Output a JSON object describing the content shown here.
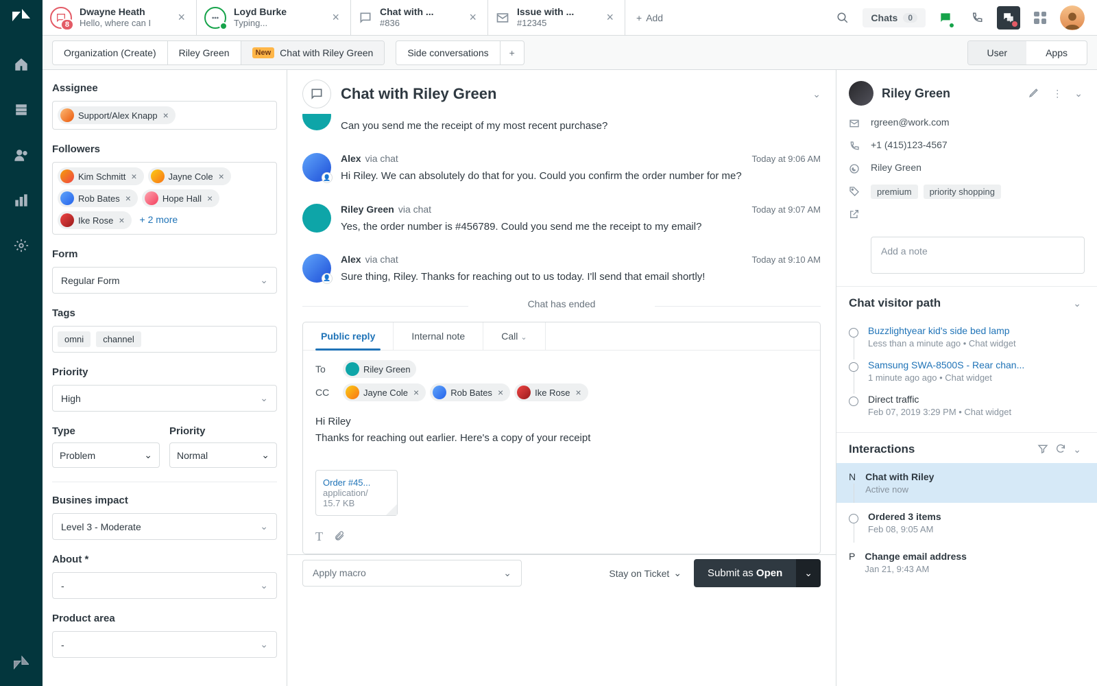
{
  "topbar": {
    "tabs": [
      {
        "title": "Dwayne Heath",
        "subtitle": "Hello, where can I",
        "badge": "8"
      },
      {
        "title": "Loyd Burke",
        "subtitle": "Typing..."
      },
      {
        "title": "Chat with ...",
        "subtitle": "#836"
      },
      {
        "title": "Issue with ...",
        "subtitle": "#12345"
      }
    ],
    "add_label": "Add",
    "chats_label": "Chats",
    "chats_count": "0"
  },
  "subbar": {
    "tab1": "Organization (Create)",
    "tab2": "Riley Green",
    "tab3_badge": "New",
    "tab3": "Chat with Riley Green",
    "side_conversations": "Side conversations",
    "user": "User",
    "apps": "Apps"
  },
  "sidebar": {
    "assignee_label": "Assignee",
    "assignee_value": "Support/Alex Knapp",
    "followers_label": "Followers",
    "followers": [
      "Kim Schmitt",
      "Jayne Cole",
      "Rob Bates",
      "Hope Hall",
      "Ike Rose"
    ],
    "followers_more": "+ 2 more",
    "form_label": "Form",
    "form_value": "Regular Form",
    "tags_label": "Tags",
    "tags": [
      "omni",
      "channel"
    ],
    "priority_label": "Priority",
    "priority_value": "High",
    "type_label": "Type",
    "type_value": "Problem",
    "priority2_label": "Priority",
    "priority2_value": "Normal",
    "business_label": "Busines impact",
    "business_value": "Level 3 - Moderate",
    "about_label": "About *",
    "about_value": "-",
    "product_label": "Product area",
    "product_value": "-"
  },
  "chat": {
    "title": "Chat with Riley Green",
    "msg0_text": "Can you send me the receipt of my most recent purchase?",
    "msg1": {
      "name": "Alex",
      "via": "via chat",
      "time": "Today at 9:06 AM",
      "text": "Hi Riley. We can absolutely do that for you. Could you confirm the order number for me?"
    },
    "msg2": {
      "name": "Riley Green",
      "via": "via chat",
      "time": "Today at 9:07 AM",
      "text": "Yes, the order number is #456789. Could you send me the receipt to my email?"
    },
    "msg3": {
      "name": "Alex",
      "via": "via chat",
      "time": "Today at 9:10 AM",
      "text": "Sure thing, Riley. Thanks for reaching out to us today. I'll send that email shortly!"
    },
    "ended": "Chat has ended"
  },
  "composer": {
    "tab_public": "Public reply",
    "tab_internal": "Internal note",
    "tab_call": "Call",
    "to_label": "To",
    "cc_label": "CC",
    "to_value": "Riley Green",
    "cc": [
      "Jayne Cole",
      "Rob Bates",
      "Ike Rose"
    ],
    "body_line1": "Hi Riley",
    "body_line2": "Thanks for reaching out earlier. Here's a copy of your receipt",
    "attachment": {
      "name": "Order #45...",
      "type": "application/",
      "size": "15.7 KB"
    }
  },
  "bottom": {
    "macro": "Apply macro",
    "stay": "Stay on Ticket",
    "submit_prefix": "Submit as ",
    "submit_status": "Open"
  },
  "right": {
    "name": "Riley Green",
    "email": "rgreen@work.com",
    "phone": "+1 (415)123-4567",
    "whatsapp": "Riley Green",
    "tags": [
      "premium",
      "priority shopping"
    ],
    "note_placeholder": "Add a note",
    "visitor_path_title": "Chat visitor path",
    "paths": [
      {
        "title": "Buzzlightyear kid's side bed lamp",
        "meta": "Less than a minute ago • Chat widget",
        "link": true
      },
      {
        "title": "Samsung SWA-8500S - Rear chan...",
        "meta": "1 minute ago ago • Chat widget",
        "link": true
      },
      {
        "title": "Direct traffic",
        "meta": "Feb 07, 2019 3:29 PM • Chat widget",
        "link": false
      }
    ],
    "interactions_title": "Interactions",
    "interactions": [
      {
        "badge": "N",
        "title": "Chat with Riley",
        "sub": "Active now",
        "active": true
      },
      {
        "title": "Ordered 3 items",
        "sub": "Feb 08, 9:05 AM"
      },
      {
        "badge": "P",
        "title": "Change email address",
        "sub": "Jan 21, 9:43 AM"
      }
    ]
  }
}
